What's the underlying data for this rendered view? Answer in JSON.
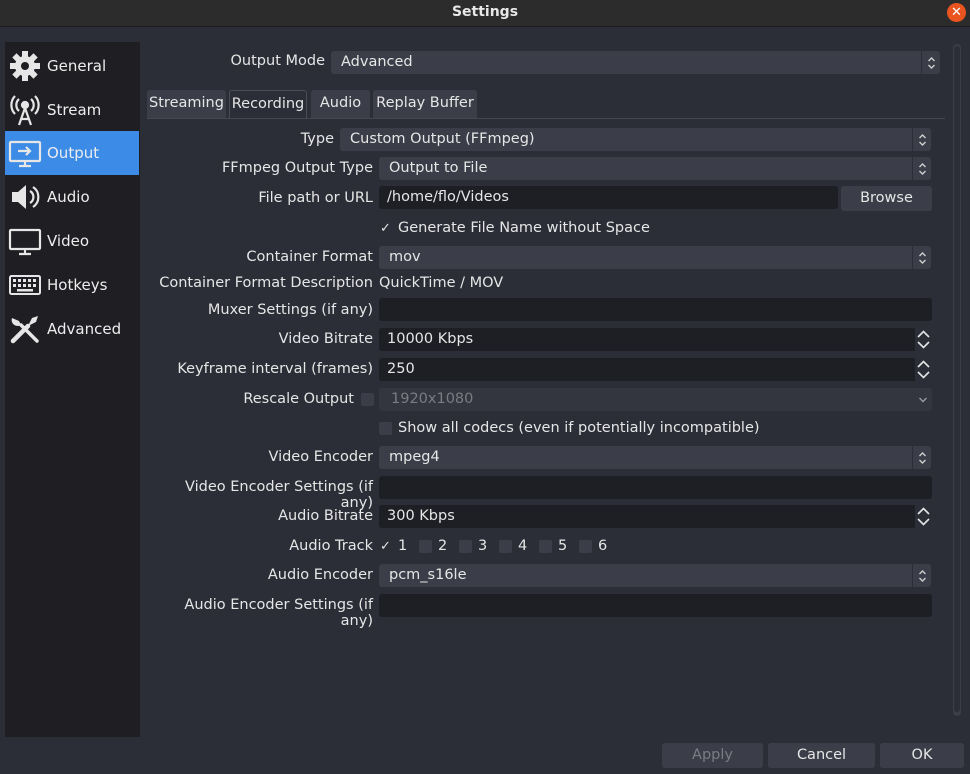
{
  "window": {
    "title": "Settings",
    "close_glyph": "✕"
  },
  "sidebar": {
    "items": [
      {
        "label": "General",
        "icon": "gear-icon"
      },
      {
        "label": "Stream",
        "icon": "broadcast-icon"
      },
      {
        "label": "Output",
        "icon": "monitor-output-icon"
      },
      {
        "label": "Audio",
        "icon": "speaker-icon"
      },
      {
        "label": "Video",
        "icon": "monitor-icon"
      },
      {
        "label": "Hotkeys",
        "icon": "keyboard-icon"
      },
      {
        "label": "Advanced",
        "icon": "tools-icon"
      }
    ],
    "active_index": 2
  },
  "output_mode": {
    "label": "Output Mode",
    "value": "Advanced"
  },
  "tabs": [
    {
      "label": "Streaming"
    },
    {
      "label": "Recording"
    },
    {
      "label": "Audio"
    },
    {
      "label": "Replay Buffer"
    }
  ],
  "active_tab": "Recording",
  "form": {
    "type": {
      "label": "Type",
      "value": "Custom Output (FFmpeg)"
    },
    "ffmpeg_output_type": {
      "label": "FFmpeg Output Type",
      "value": "Output to File"
    },
    "file_path": {
      "label": "File path or URL",
      "value": "/home/flo/Videos",
      "browse": "Browse"
    },
    "gen_filename": {
      "label": "Generate File Name without Space",
      "checked": true,
      "check_glyph": "✓"
    },
    "container_format": {
      "label": "Container Format",
      "value": "mov"
    },
    "container_desc": {
      "label": "Container Format Description",
      "value": "QuickTime / MOV"
    },
    "muxer_settings": {
      "label": "Muxer Settings (if any)",
      "value": ""
    },
    "video_bitrate": {
      "label": "Video Bitrate",
      "value": "10000 Kbps"
    },
    "keyframe_interval": {
      "label": "Keyframe interval (frames)",
      "value": "250"
    },
    "rescale_output": {
      "label": "Rescale Output",
      "checked": false,
      "value": "1920x1080"
    },
    "show_all_codecs": {
      "label": "Show all codecs (even if potentially incompatible)",
      "checked": false
    },
    "video_encoder": {
      "label": "Video Encoder",
      "value": "mpeg4"
    },
    "video_encoder_settings": {
      "label": "Video Encoder Settings (if any)",
      "value": ""
    },
    "audio_bitrate": {
      "label": "Audio Bitrate",
      "value": "300 Kbps"
    },
    "audio_track": {
      "label": "Audio Track",
      "tracks": [
        {
          "label": "1",
          "checked": true
        },
        {
          "label": "2",
          "checked": false
        },
        {
          "label": "3",
          "checked": false
        },
        {
          "label": "4",
          "checked": false
        },
        {
          "label": "5",
          "checked": false
        },
        {
          "label": "6",
          "checked": false
        }
      ]
    },
    "audio_encoder": {
      "label": "Audio Encoder",
      "value": "pcm_s16le"
    },
    "audio_encoder_settings": {
      "label": "Audio Encoder Settings (if any)",
      "value": ""
    }
  },
  "footer": {
    "apply": "Apply",
    "cancel": "Cancel",
    "ok": "OK"
  },
  "colors": {
    "accent": "#3c8ce7",
    "close": "#e95420",
    "background": "#2b2e37",
    "sidebar": "#1f1f23"
  }
}
